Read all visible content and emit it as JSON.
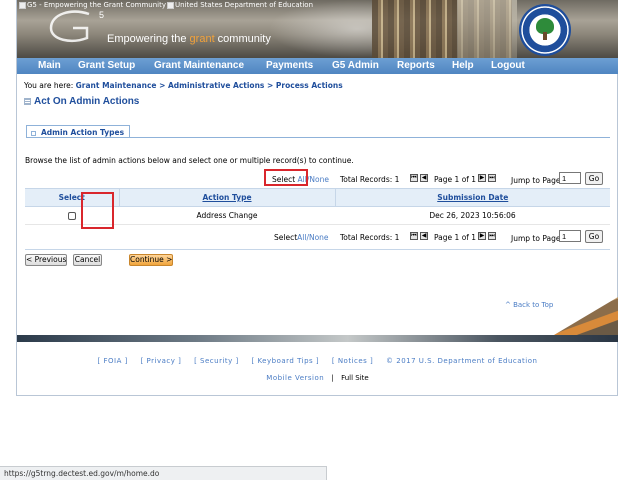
{
  "header": {
    "logo_alt": "G5 - Empowering the Grant Community",
    "doe_alt": "United States Department of Education",
    "logo_text": "G",
    "logo_superscript": "5",
    "tagline_prefix": "Empowering the ",
    "tagline_accent": "grant",
    "tagline_suffix": " community"
  },
  "nav": {
    "items": [
      "Main",
      "Grant Setup",
      "Grant Maintenance",
      "Payments",
      "G5 Admin",
      "Reports",
      "Help",
      "Logout"
    ]
  },
  "breadcrumb": {
    "prefix": "You are here: ",
    "items": [
      "Grant Maintenance",
      "Administrative Actions",
      "Process Actions"
    ],
    "separator": " > "
  },
  "page": {
    "title": "Act On Admin Actions"
  },
  "tab": {
    "label": "Admin Action Types"
  },
  "intro_text": "Browse the list of admin actions below and select one or multiple record(s) to continue.",
  "pager": {
    "select_prefix": "Select ",
    "select_all": "All",
    "select_slash": "/",
    "select_none": "None",
    "total_records": "Total Records: 1",
    "page_of": "Page 1 of 1",
    "jump_label": "Jump to Page",
    "jump_value": "1",
    "go_label": "Go",
    "first_icon": "⏮",
    "prev_icon": "◀",
    "next_icon": "▶",
    "last_icon": "⏭"
  },
  "table": {
    "columns": [
      "Select",
      "Action Type",
      "Submission Date"
    ],
    "rows": [
      {
        "checked": false,
        "action_type": "Address Change",
        "submission_date": "Dec 26, 2023 10:56:06"
      }
    ]
  },
  "buttons": {
    "previous": "< Previous",
    "cancel": "Cancel",
    "continue": "Continue >"
  },
  "back_to_top": "^ Back to Top",
  "footer": {
    "links": [
      "[ FOIA ]",
      "[ Privacy ]",
      "[ Security ]",
      "[ Keyboard Tips ]",
      "[ Notices ]"
    ],
    "copyright": "© 2017 U.S. Department of Education",
    "mobile": "Mobile Version",
    "divider": "|",
    "full": "Full Site"
  },
  "status_bar": {
    "url": "https://g5trng.dectest.ed.gov/m/home.do"
  },
  "colors": {
    "nav": "#4f85c1",
    "link": "#1f4e9c",
    "highlight": "#d9262c",
    "accent": "#f2a23a"
  }
}
